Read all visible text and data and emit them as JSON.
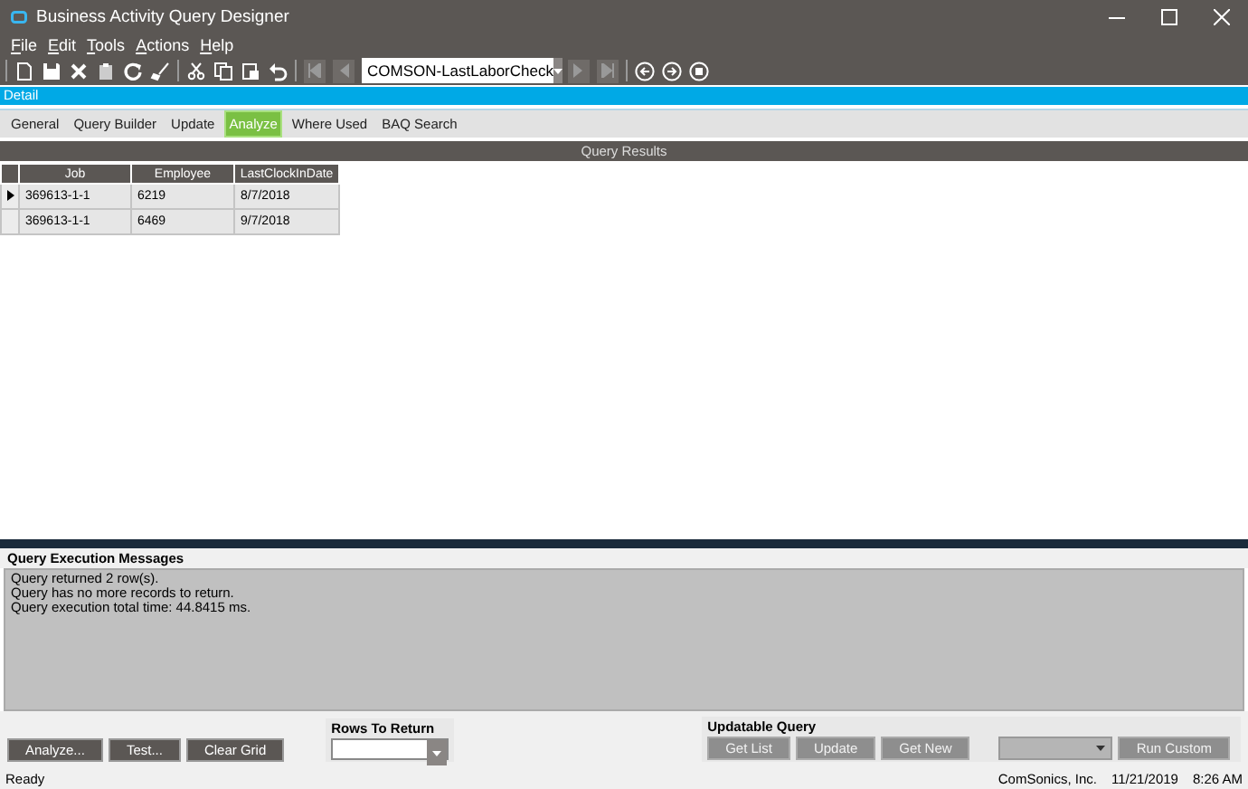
{
  "window": {
    "title": "Business Activity Query Designer"
  },
  "menu": [
    {
      "label": "File"
    },
    {
      "label": "Edit"
    },
    {
      "label": "Tools"
    },
    {
      "label": "Actions"
    },
    {
      "label": "Help"
    }
  ],
  "toolbar": {
    "query_id": "COMSON-LastLaborCheck"
  },
  "detail_bar": {
    "title": "Detail"
  },
  "tabs": [
    {
      "label": "General",
      "selected": false
    },
    {
      "label": "Query Builder",
      "selected": false
    },
    {
      "label": "Update",
      "selected": false
    },
    {
      "label": "Analyze",
      "selected": true
    },
    {
      "label": "Where Used",
      "selected": false
    },
    {
      "label": "BAQ Search",
      "selected": false
    }
  ],
  "results": {
    "title": "Query Results",
    "columns": [
      "Job",
      "Employee",
      "LastClockInDate"
    ],
    "rows": [
      {
        "selected": true,
        "cells": [
          "369613-1-1",
          "6219",
          "8/7/2018"
        ]
      },
      {
        "selected": false,
        "cells": [
          "369613-1-1",
          "6469",
          "9/7/2018"
        ]
      }
    ]
  },
  "messages": {
    "title": "Query Execution Messages",
    "lines": [
      "Query returned 2 row(s).",
      "Query has no more records to return.",
      "Query execution total time: 44.8415 ms."
    ]
  },
  "actions": [
    {
      "label": "Analyze...",
      "disabled": false
    },
    {
      "label": "Test...",
      "disabled": false
    },
    {
      "label": "Clear Grid",
      "disabled": false
    }
  ],
  "rows_to_return": {
    "label": "Rows To Return"
  },
  "updatable_query": {
    "title": "Updatable Query",
    "buttons": [
      {
        "label": "Get List",
        "disabled": true
      },
      {
        "label": "Update",
        "disabled": true
      },
      {
        "label": "Get New",
        "disabled": true
      }
    ],
    "run_custom": {
      "label": "Run Custom",
      "disabled": true
    }
  },
  "status_bar": {
    "status": "Ready",
    "company": "ComSonics, Inc.",
    "date": "11/21/2019",
    "time": "8:26 AM"
  }
}
